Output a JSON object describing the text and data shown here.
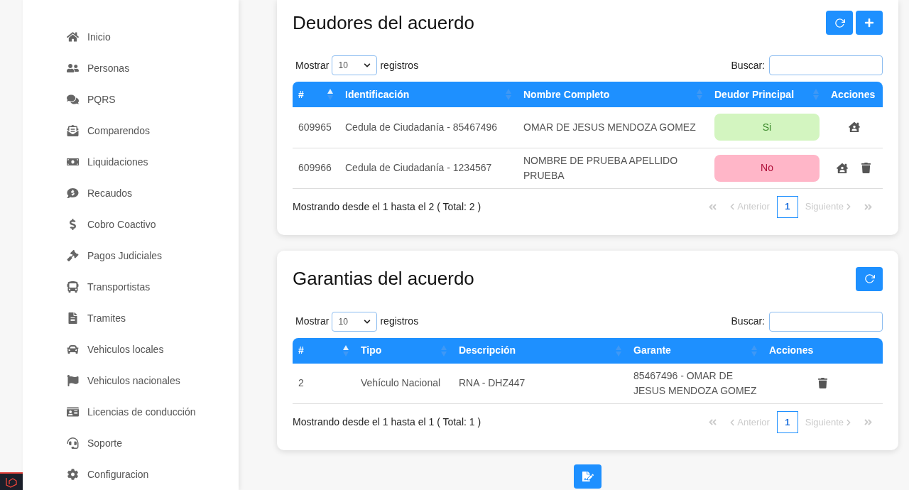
{
  "sidebar": {
    "items": [
      {
        "label": "Inicio"
      },
      {
        "label": "Personas"
      },
      {
        "label": "PQRS"
      },
      {
        "label": "Comparendos"
      },
      {
        "label": "Liquidaciones"
      },
      {
        "label": "Recaudos"
      },
      {
        "label": "Cobro Coactivo"
      },
      {
        "label": "Pagos Judiciales"
      },
      {
        "label": "Transportistas"
      },
      {
        "label": "Tramites"
      },
      {
        "label": "Vehiculos locales"
      },
      {
        "label": "Vehiculos nacionales"
      },
      {
        "label": "Licencias de conducción"
      },
      {
        "label": "Soporte"
      },
      {
        "label": "Configuracion"
      }
    ]
  },
  "cards": [
    {
      "title": "Deudores del acuerdo",
      "buttons": [
        {
          "kind": "refresh"
        },
        {
          "kind": "add"
        }
      ],
      "length": {
        "before": "Mostrar",
        "value": "10",
        "after": "registros"
      },
      "search": {
        "label": "Buscar:"
      },
      "columns": [
        {
          "label": "#",
          "sortable": true,
          "sorted": true
        },
        {
          "label": "Identificación",
          "sortable": true,
          "sorted": false
        },
        {
          "label": "Nombre Completo",
          "sortable": true,
          "sorted": false
        },
        {
          "label": "Deudor Principal",
          "sortable": true,
          "sorted": false
        },
        {
          "label": "Acciones",
          "sortable": false
        }
      ],
      "rows": [
        {
          "cells": [
            "609965",
            "Cedula de Ciudadanía - 85467496",
            "OMAR DE JESUS MENDOZA GOMEZ"
          ],
          "status": {
            "label": "Si",
            "principal": true
          },
          "actions": [
            {
              "kind": "home"
            }
          ]
        },
        {
          "cells": [
            "609966",
            "Cedula de Ciudadanía - 1234567",
            "NOMBRE DE PRUEBA APELLIDO PRUEBA"
          ],
          "status": {
            "label": "No",
            "principal": false
          },
          "actions": [
            {
              "kind": "home"
            },
            {
              "kind": "delete"
            }
          ]
        }
      ],
      "info": "Mostrando desde el 1 hasta el 2 ( Total: 2 )",
      "pagination": {
        "previous": "Anterior",
        "next": "Siguiente",
        "pages": [
          {
            "label": "1",
            "selected": true
          }
        ]
      }
    },
    {
      "title": "Garantias del acuerdo",
      "buttons": [
        {
          "kind": "refresh"
        }
      ],
      "length": {
        "before": "Mostrar",
        "value": "10",
        "after": "registros"
      },
      "search": {
        "label": "Buscar:"
      },
      "columns": [
        {
          "label": "#",
          "sortable": true,
          "sorted": true
        },
        {
          "label": "Tipo",
          "sortable": true,
          "sorted": false
        },
        {
          "label": "Descripción",
          "sortable": true,
          "sorted": false
        },
        {
          "label": "Garante",
          "sortable": true,
          "sorted": false
        },
        {
          "label": "Acciones",
          "sortable": false
        }
      ],
      "rows": [
        {
          "cells": [
            "2",
            "Vehículo Nacional",
            "RNA - DHZ447",
            "85467496 - OMAR DE JESUS MENDOZA GOMEZ"
          ],
          "actions": [
            {
              "kind": "delete"
            }
          ]
        }
      ],
      "info": "Mostrando desde el 1 hasta el 1 ( Total: 1 )",
      "pagination": {
        "previous": "Anterior",
        "next": "Siguiente",
        "pages": [
          {
            "label": "1",
            "selected": true
          }
        ]
      }
    }
  ],
  "footer_button": {
    "kind": "sign"
  }
}
